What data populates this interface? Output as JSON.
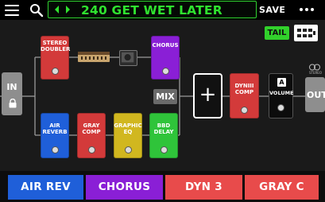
{
  "header": {
    "preset_name": "240 GET WET LATER",
    "save_label": "SAVE",
    "menu_icon": "hamburger-icon",
    "search_icon": "search-icon",
    "more_icon": "more-icon"
  },
  "signal_flow": {
    "tail_label": "TAIL",
    "input_label": "IN",
    "output_label": "OUT",
    "mix_label": "MIX",
    "add_label": "+",
    "stereo_label": "STEREO",
    "upper_path": [
      {
        "label": "STEREO\nDOUBLER",
        "color": "#d33a3a"
      },
      {
        "label": "CHORUS",
        "color": "#8a1fd6"
      }
    ],
    "lower_path": [
      {
        "label": "AIR\nREVERB",
        "color": "#1f5fd9"
      },
      {
        "label": "GRAY\nCOMP",
        "color": "#d33a3a"
      },
      {
        "label": "GRAPHIC\nEQ",
        "color": "#d1b71f"
      },
      {
        "label": "BBD\nDELAY",
        "color": "#2fc43a"
      }
    ],
    "post_blocks": [
      {
        "label": "DYNIII\nCOMP",
        "color": "#d33a3a"
      },
      {
        "label": "VOLUME",
        "badge": "A",
        "color": "#0c0c0c"
      }
    ]
  },
  "footer": {
    "buttons": [
      {
        "label": "AIR REV",
        "color": "#1f5fd9"
      },
      {
        "label": "CHORUS",
        "color": "#8a1fd6"
      },
      {
        "label": "DYN 3",
        "color": "#e84b4b"
      },
      {
        "label": "GRAY C",
        "color": "#e84b4b"
      }
    ]
  }
}
